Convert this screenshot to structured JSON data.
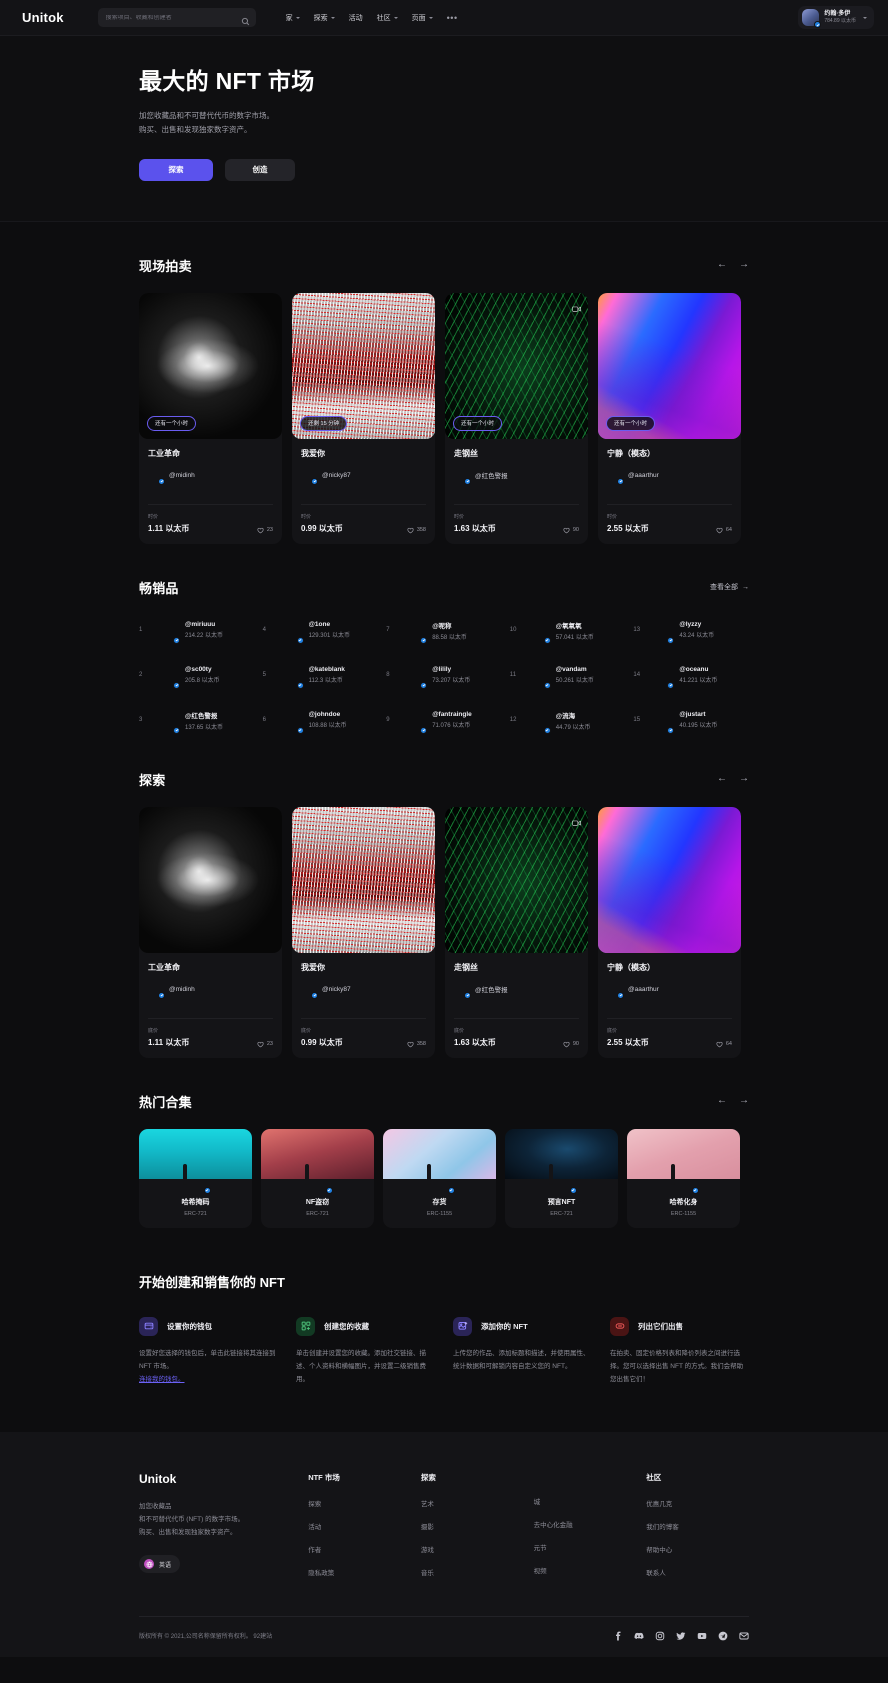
{
  "brand": "Unitok",
  "nav": {
    "search_placeholder": "搜索项目、收藏和创建者",
    "links": [
      {
        "label": "家",
        "caret": true
      },
      {
        "label": "探索",
        "caret": true
      },
      {
        "label": "活动",
        "caret": false
      },
      {
        "label": "社区",
        "caret": true
      },
      {
        "label": "页面",
        "caret": true
      }
    ],
    "more": "•••",
    "user": {
      "name": "约翰·多伊",
      "balance": "784.89 以太币"
    }
  },
  "hero": {
    "title": "最大的 NFT 市场",
    "sub_line1": "加您收藏品和不可替代代币的数字市场。",
    "sub_line2": "购买、出售和发现独家数字资产。",
    "primary_label": "探索",
    "secondary_label": "创造"
  },
  "live_auction": {
    "title": "现场拍卖",
    "prev": "←",
    "next": "→",
    "price_label": "时价",
    "cards": [
      {
        "badge": "还有一个小时",
        "title": "工业革命",
        "creator": "@midinh",
        "price": "1.11 以太币",
        "likes": "23",
        "media": "m0",
        "av": "av-midinh",
        "corner": false
      },
      {
        "badge": "还剩 15 分钟",
        "title": "我爱你",
        "creator": "@nicky87",
        "price": "0.99 以太币",
        "likes": "358",
        "media": "m1",
        "av": "av-nicky",
        "corner": false
      },
      {
        "badge": "还有一个小时",
        "title": "走钢丝",
        "creator": "@红色警报",
        "price": "1.63 以太币",
        "likes": "90",
        "media": "m2",
        "av": "av-red",
        "corner": true
      },
      {
        "badge": "还有一个小时",
        "title": "宁静（模态）",
        "creator": "@aaarthur",
        "price": "2.55 以太币",
        "likes": "64",
        "media": "m3",
        "av": "av-arthur",
        "corner": false
      }
    ]
  },
  "best_sellers": {
    "title": "畅销品",
    "see_all": "查看全部",
    "see_all_arrow": "→",
    "items": [
      {
        "rank": "1",
        "name": "@miriuuu",
        "value": "214.22 以太币",
        "av": "av-miriuuu"
      },
      {
        "rank": "2",
        "name": "@sc00ty",
        "value": "205.8 以太币",
        "av": "av-sc00ty"
      },
      {
        "rank": "3",
        "name": "@红色警报",
        "value": "137.65 以太币",
        "av": "av-redp"
      },
      {
        "rank": "4",
        "name": "@1one",
        "value": "129.301 以太币",
        "av": "av-1one"
      },
      {
        "rank": "5",
        "name": "@kateblank",
        "value": "112.3 以太币",
        "av": "av-kate"
      },
      {
        "rank": "6",
        "name": "@johndoe",
        "value": "108.88 以太币",
        "av": "av-john"
      },
      {
        "rank": "7",
        "name": "@呢称",
        "value": "88.58 以太币",
        "av": "av-nini"
      },
      {
        "rank": "8",
        "name": "@lilily",
        "value": "73.207 以太币",
        "av": "av-lilly"
      },
      {
        "rank": "9",
        "name": "@fantraingle",
        "value": "71.076 以太币",
        "av": "av-fan"
      },
      {
        "rank": "10",
        "name": "@氧氧氧",
        "value": "57.041 以太币",
        "av": "av-oxy"
      },
      {
        "rank": "11",
        "name": "@vandam",
        "value": "50.261 以太币",
        "av": "av-vandam"
      },
      {
        "rank": "12",
        "name": "@流海",
        "value": "44.79 以太币",
        "av": "av-liuhai"
      },
      {
        "rank": "13",
        "name": "@lyzzy",
        "value": "43.24 以太币",
        "av": "av-lyzzy"
      },
      {
        "rank": "14",
        "name": "@oceanu",
        "value": "41.221 以太币",
        "av": "av-oceanu"
      },
      {
        "rank": "15",
        "name": "@justart",
        "value": "40.195 以太币",
        "av": "av-justart"
      }
    ]
  },
  "explore": {
    "title": "探索",
    "prev": "←",
    "next": "→",
    "price_label": "底价",
    "cards": [
      {
        "title": "工业革命",
        "creator": "@midinh",
        "price": "1.11 以太币",
        "likes": "23",
        "media": "m0",
        "av": "av-midinh",
        "corner": false
      },
      {
        "title": "我爱你",
        "creator": "@nicky87",
        "price": "0.99 以太币",
        "likes": "358",
        "media": "m1",
        "av": "av-nicky",
        "corner": false
      },
      {
        "title": "走钢丝",
        "creator": "@红色警报",
        "price": "1.63 以太币",
        "likes": "90",
        "media": "m2",
        "av": "av-red",
        "corner": true
      },
      {
        "title": "宁静（模态）",
        "creator": "@aaarthur",
        "price": "2.55 以太币",
        "likes": "64",
        "media": "m3",
        "av": "av-arthur",
        "corner": false
      }
    ]
  },
  "collections": {
    "title": "热门合集",
    "prev": "←",
    "next": "→",
    "items": [
      {
        "name": "哈希掩码",
        "standard": "ERC-721",
        "banner": "cb0",
        "av": "av-redp"
      },
      {
        "name": "NF盗窃",
        "standard": "ERC-721",
        "banner": "cb1",
        "av": "av-fan"
      },
      {
        "name": "存货",
        "standard": "ERC-1155",
        "banner": "cb2",
        "av": "av-liuhai"
      },
      {
        "name": "预言NFT",
        "standard": "ERC-721",
        "banner": "cb3",
        "av": "av-oceanu"
      },
      {
        "name": "哈希化身",
        "standard": "ERC-1155",
        "banner": "cb4",
        "av": "av-1one"
      }
    ]
  },
  "get_started": {
    "title": "开始创建和销售你的 NFT",
    "steps": [
      {
        "icon": "wallet-icon",
        "icon_class": "gs-i0",
        "name": "设置你的钱包",
        "desc": "设置好您选择的钱包后，单击此链接将其连接到 NFT 市场。",
        "link": "连接我的钱包。"
      },
      {
        "icon": "grid-plus-icon",
        "icon_class": "gs-i1",
        "name": "创建您的收藏",
        "desc": "单击创建并设置您的收藏。添加社交链接、描述、个人资料和横幅图片，并设置二级销售费用。",
        "link": ""
      },
      {
        "icon": "image-plus-icon",
        "icon_class": "gs-i2",
        "name": "添加你的 NFT",
        "desc": "上传您的作品、添加标题和描述，并使用属性、统计数据和可解锁内容自定义您的 NFT。",
        "link": ""
      },
      {
        "icon": "tag-icon",
        "icon_class": "gs-i3",
        "name": "列出它们出售",
        "desc": "在拍卖、固定价格列表和降价列表之间进行选择。您可以选择出售 NFT 的方式。我们会帮助您出售它们！",
        "link": ""
      }
    ]
  },
  "footer": {
    "brand": "Unitok",
    "desc_line1": "加您收藏品",
    "desc_line2": "和不可替代代币 (NFT) 的数字市场。",
    "desc_line3": "购买、出售和发现独家数字资产。",
    "language": "英语",
    "columns": [
      {
        "title": "NTF 市场",
        "links": [
          "探索",
          "活动",
          "作者",
          "隐私政策"
        ]
      },
      {
        "title": "探索",
        "links": [
          "艺术",
          "摄影",
          "游戏",
          "音乐"
        ]
      },
      {
        "title": "",
        "links": [
          "城",
          "去中心化金融",
          "元节",
          "视频"
        ]
      },
      {
        "title": "社区",
        "links": [
          "优惠几克",
          "我们的博客",
          "帮助中心",
          "联系人"
        ]
      }
    ],
    "copyright": "版权所有 © 2021,公司名称保留所有权利。 92建站",
    "socials": [
      "facebook-icon",
      "discord-icon",
      "instagram-icon",
      "twitter-icon",
      "youtube-icon",
      "telegram-icon",
      "email-icon"
    ]
  }
}
